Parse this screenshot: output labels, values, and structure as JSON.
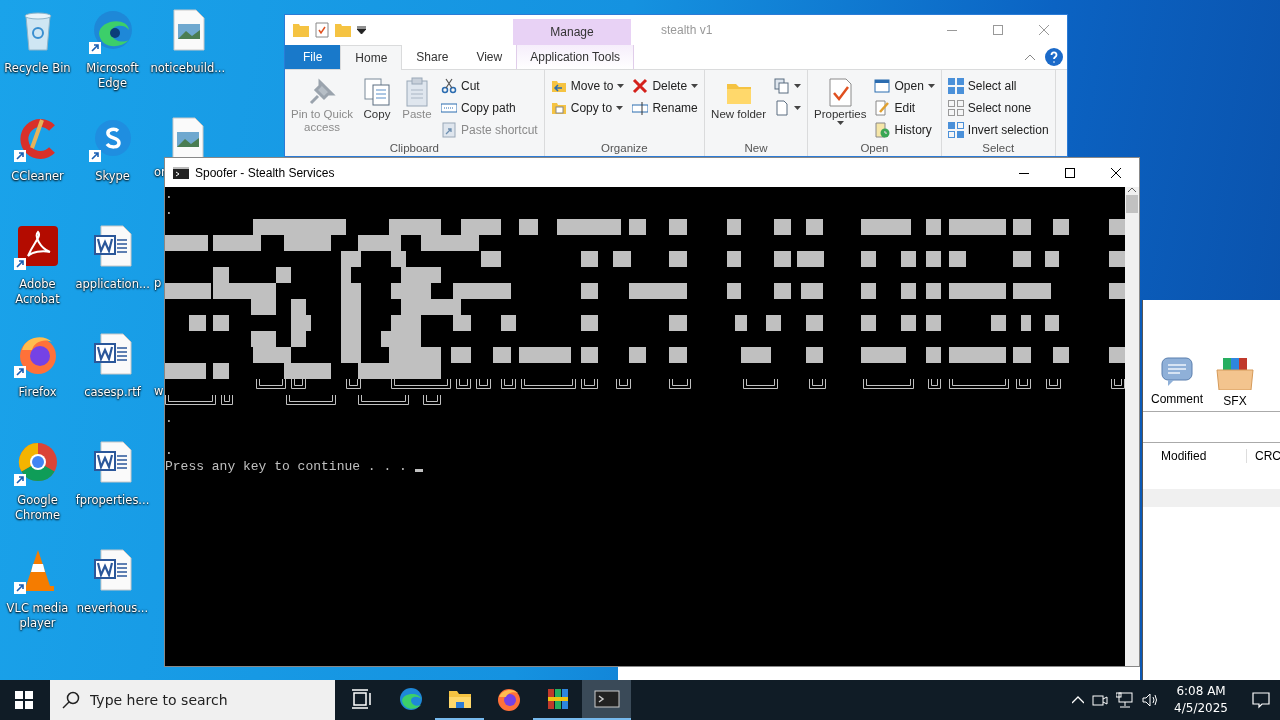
{
  "desktop": {
    "columns": [
      [
        {
          "label": "Recycle Bin",
          "kind": "full",
          "shortcut": false
        },
        {
          "label": "CCleaner",
          "kind": "full",
          "shortcut": true
        },
        {
          "label": "Adobe Acrobat",
          "kind": "full",
          "shortcut": true
        },
        {
          "label": "Firefox",
          "kind": "full",
          "shortcut": true
        },
        {
          "label": "Google Chrome",
          "kind": "full",
          "shortcut": true
        },
        {
          "label": "VLC media player",
          "kind": "full",
          "shortcut": true
        }
      ],
      [
        {
          "label": "Microsoft Edge",
          "kind": "full",
          "shortcut": true
        },
        {
          "label": "Skype",
          "kind": "full",
          "shortcut": true
        },
        {
          "label": "application...",
          "kind": "full",
          "shortcut": false
        },
        {
          "label": "casesp.rtf",
          "kind": "full",
          "shortcut": false
        },
        {
          "label": "fproperties...",
          "kind": "full",
          "shortcut": false
        },
        {
          "label": "neverhous...",
          "kind": "full",
          "shortcut": false
        }
      ],
      [
        {
          "label": "noticebuild...",
          "kind": "full",
          "shortcut": false
        },
        {
          "label": "or",
          "kind": "cut",
          "shortcut": false
        },
        {
          "label": "p",
          "kind": "label"
        },
        {
          "label": "w",
          "kind": "label"
        }
      ]
    ]
  },
  "explorer": {
    "title": "stealth v1",
    "context_tab": "Manage",
    "tabs": [
      {
        "label": "File",
        "kind": "file",
        "selected": false
      },
      {
        "label": "Home",
        "kind": "tab",
        "selected": true
      },
      {
        "label": "Share",
        "kind": "tab",
        "selected": false
      },
      {
        "label": "View",
        "kind": "tab",
        "selected": false
      },
      {
        "label": "Application Tools",
        "kind": "context",
        "selected": false
      }
    ],
    "groups": [
      {
        "label": "Clipboard",
        "columns": [
          {
            "kind": "large",
            "buttons": [
              {
                "label": "Pin to Quick access",
                "disabled": true,
                "menu": false
              }
            ]
          },
          {
            "kind": "large",
            "buttons": [
              {
                "label": "Copy",
                "disabled": false,
                "menu": false
              }
            ]
          },
          {
            "kind": "large",
            "buttons": [
              {
                "label": "Paste",
                "disabled": true,
                "menu": false
              }
            ]
          },
          {
            "kind": "stack",
            "buttons": [
              {
                "label": "Cut",
                "disabled": false,
                "menu": false
              },
              {
                "label": "Copy path",
                "disabled": false,
                "menu": false
              },
              {
                "label": "Paste shortcut",
                "disabled": true,
                "menu": false
              }
            ]
          }
        ]
      },
      {
        "label": "Organize",
        "columns": [
          {
            "kind": "stack",
            "buttons": [
              {
                "label": "Move to",
                "disabled": false,
                "menu": true
              },
              {
                "label": "Copy to",
                "disabled": false,
                "menu": true
              }
            ]
          },
          {
            "kind": "stack",
            "buttons": [
              {
                "label": "Delete",
                "disabled": false,
                "menu": true
              },
              {
                "label": "Rename",
                "disabled": false,
                "menu": false
              }
            ]
          }
        ]
      },
      {
        "label": "New",
        "columns": [
          {
            "kind": "large",
            "buttons": [
              {
                "label": "New folder",
                "disabled": false,
                "menu": false
              }
            ]
          },
          {
            "kind": "icons",
            "buttons": [
              {
                "menu": true
              },
              {
                "menu": true
              }
            ]
          }
        ]
      },
      {
        "label": "Open",
        "columns": [
          {
            "kind": "large",
            "buttons": [
              {
                "label": "Properties",
                "disabled": false,
                "menu": true
              }
            ]
          },
          {
            "kind": "stack",
            "buttons": [
              {
                "label": "Open",
                "disabled": false,
                "menu": true
              },
              {
                "label": "Edit",
                "disabled": false,
                "menu": false
              },
              {
                "label": "History",
                "disabled": false,
                "menu": false
              }
            ]
          }
        ]
      },
      {
        "label": "Select",
        "columns": [
          {
            "kind": "stack",
            "buttons": [
              {
                "label": "Select all",
                "disabled": false,
                "menu": false
              },
              {
                "label": "Select none",
                "disabled": false,
                "menu": false
              },
              {
                "label": "Invert selection",
                "disabled": false,
                "menu": false
              }
            ]
          }
        ]
      }
    ]
  },
  "console": {
    "title": "Spoofer - Stealth Services",
    "lines": [
      {
        "kind": "text",
        "text": "."
      },
      {
        "kind": "text",
        "text": "."
      },
      {
        "kind": "art"
      },
      {
        "kind": "text",
        "text": "."
      },
      {
        "kind": "blank"
      },
      {
        "kind": "text",
        "text": "."
      },
      {
        "kind": "prompt",
        "text": "Press any key to continue . . ."
      }
    ]
  },
  "archiver": {
    "toolbar": [
      "Comment",
      "SFX"
    ],
    "columns": [
      "Modified",
      "CRC"
    ]
  },
  "taskbar": {
    "search": {
      "placeholder": "Type here to search"
    },
    "apps": [
      {
        "running": false,
        "selected": false
      },
      {
        "running": false,
        "selected": false
      },
      {
        "running": true,
        "selected": false
      },
      {
        "running": false,
        "selected": false
      },
      {
        "running": true,
        "selected": false
      },
      {
        "running": true,
        "selected": true
      }
    ],
    "time": "6:08 AM",
    "date": "4/5/2025"
  }
}
